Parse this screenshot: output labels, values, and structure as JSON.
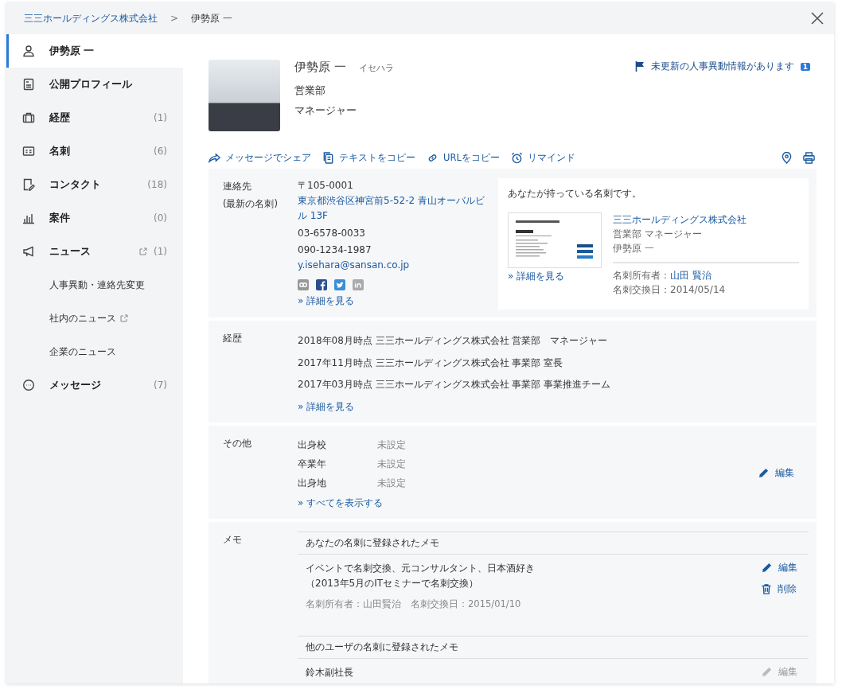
{
  "breadcrumb": {
    "company": "三三ホールディングス株式会社",
    "separator": ">",
    "current": "伊勢原 一"
  },
  "sidebar": {
    "items": [
      {
        "label": "伊勢原 一",
        "selected": true,
        "external": false
      },
      {
        "label": "公開プロフィール",
        "selected": false,
        "external": false
      },
      {
        "label": "経歴",
        "count": "(1)",
        "selected": false,
        "external": false
      },
      {
        "label": "名刺",
        "count": "(6)",
        "selected": false,
        "external": false
      },
      {
        "label": "コンタクト",
        "count": "(18)",
        "selected": false,
        "external": false
      },
      {
        "label": "案件",
        "count": "(0)",
        "selected": false,
        "external": false
      },
      {
        "label": "ニュース",
        "count": "(1)",
        "selected": false,
        "external": true,
        "children": [
          {
            "label": "人事異動・連絡先変更",
            "external": false
          },
          {
            "label": "社内のニュース",
            "external": true
          },
          {
            "label": "企業のニュース",
            "external": false
          }
        ]
      },
      {
        "label": "メッセージ",
        "count": "(7)",
        "selected": false,
        "external": false
      }
    ]
  },
  "profile": {
    "name": "伊勢原 一",
    "reading": "イセハラ",
    "department": "営業部",
    "title": "マネージャー",
    "notice": "未更新の人事異動情報があります",
    "notice_count": "1"
  },
  "actions": [
    "メッセージでシェア",
    "テキストをコピー",
    "URLをコピー",
    "リマインド"
  ],
  "contact": {
    "label": "連絡先",
    "sublabel": "(最新の名刺)",
    "postal": "〒105-0001",
    "address": "東京都渋谷区神宮前5-52-2 青山オーバルビル 13F",
    "phones": [
      "03-6578-0033",
      "090-1234-1987"
    ],
    "email": "y.isehara@sansan.co.jp",
    "more": "» 詳細を見る",
    "card": {
      "heading": "あなたが持っている名刺です。",
      "company": "三三ホールディングス株式会社",
      "position": "営業部 マネージャー",
      "name": "伊勢原 一",
      "owner_label": "名刺所有者：",
      "owner": "山田 賢治",
      "exchange": "名刺交換日：2014/05/14",
      "more": "» 詳細を見る"
    }
  },
  "career": {
    "label": "経歴",
    "entries": [
      "2018年08月時点 三三ホールディングス株式会社 営業部　マネージャー",
      "2017年11月時点 三三ホールディングス株式会社 事業部 室長",
      "2017年03月時点 三三ホールディングス株式会社 事業部 事業推進チーム"
    ],
    "more": "» 詳細を見る"
  },
  "other": {
    "label": "その他",
    "fields": [
      {
        "name": "出身校",
        "value": "未設定"
      },
      {
        "name": "卒業年",
        "value": "未設定"
      },
      {
        "name": "出身地",
        "value": "未設定"
      }
    ],
    "more": "» すべてを表示する",
    "edit": "編集"
  },
  "memo": {
    "label": "メモ",
    "groups": [
      {
        "heading": "あなたの名刺に登録されたメモ",
        "memos": [
          {
            "lines": [
              "イベントで名刺交換、元コンサルタント、日本酒好き",
              "（2013年5月のITセミナーで名刺交換）"
            ],
            "meta": "名刺所有者：山田賢治　名刺交換日：2015/01/10",
            "disabled": false,
            "edit": "編集",
            "delete": "削除"
          }
        ]
      },
      {
        "heading": "他のユーザの名刺に登録されたメモ",
        "memos": [
          {
            "lines": [
              "鈴木副社長"
            ],
            "disabled": true,
            "edit": "編集"
          }
        ]
      }
    ]
  }
}
